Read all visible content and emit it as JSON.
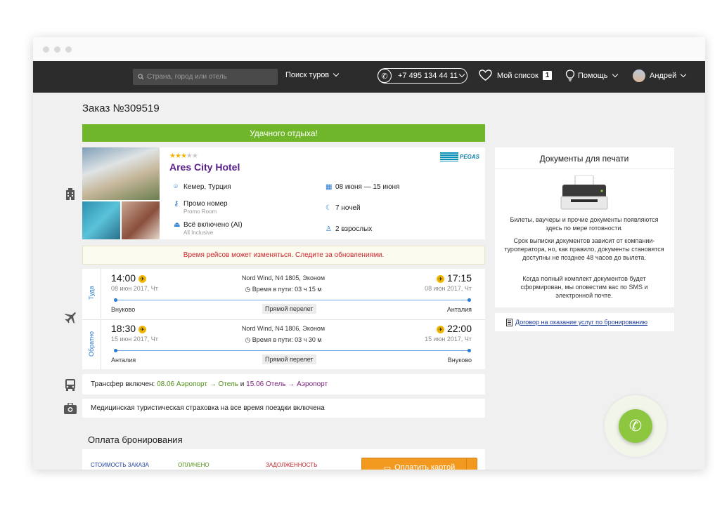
{
  "header": {
    "search_placeholder": "Страна, город или отель",
    "tours_label": "Поиск туров",
    "phone": "+7 495 134 44 11",
    "wishlist_label": "Мой список",
    "wishlist_count": "1",
    "help_label": "Помощь",
    "user_name": "Андрей"
  },
  "order": {
    "title": "Заказ №309519",
    "banner": "Удачного отдыха!"
  },
  "hotel": {
    "stars": 3,
    "stars_max": 5,
    "name": "Ares City Hotel",
    "operator": "PEGAS",
    "location": "Кемер, Турция",
    "dates": "08 июня — 15 июня",
    "room": "Промо номер",
    "room_sub": "Promo Room",
    "nights": "7 ночей",
    "board": "Всё включено (AI)",
    "board_sub": "All Inclusive",
    "guests": "2 взрослых"
  },
  "notice": "Время рейсов может изменяться. Следите за обновлениями.",
  "flights": [
    {
      "direction": "Туда",
      "dep_time": "14:00",
      "dep_date": "08 июн 2017, Чт",
      "flight": "Nord Wind, N4 1805, Эконом",
      "duration": "Время в пути: 03 ч 15 м",
      "arr_time": "17:15",
      "arr_date": "08 июн 2017, Чт",
      "from": "Внуково",
      "type": "Прямой перелет",
      "to": "Анталия"
    },
    {
      "direction": "Обратно",
      "dep_time": "18:30",
      "dep_date": "15 июн 2017, Чт",
      "flight": "Nord Wind, N4 1806, Эконом",
      "duration": "Время в пути: 03 ч 30 м",
      "arr_time": "22:00",
      "arr_date": "15 июн 2017, Чт",
      "from": "Анталия",
      "type": "Прямой перелет",
      "to": "Внуково"
    }
  ],
  "transfer": {
    "prefix": "Трансфер включен:",
    "part1": "08.06 Аэропорт",
    "arrow1": "→",
    "part1b": "Отель",
    "and": "и",
    "part2": "15.06 Отель",
    "arrow2": "→",
    "part2b": "Аэропорт"
  },
  "insurance": "Медицинская туристическая страховка на все время поездки включена",
  "documents": {
    "title": "Документы для печати",
    "p1": "Билеты, ваучеры и прочие документы появляются здесь по мере готовности.",
    "p2": "Срок выписки документов зависит от компании-туроператора, но, как правило, документы становятся доступны не позднее 48 часов до вылета.",
    "p3": "Когда полный комплект документов будет сформирован, мы оповестим вас по SMS и электронной почте.",
    "contract_link": "Договор на оказание услуг по бронированию"
  },
  "payment": {
    "title": "Оплата бронирования",
    "cost_label": "СТОИМОСТЬ ЗАКАЗА",
    "paid_label": "ОПЛАЧЕНО",
    "debt_label": "ЗАДОЛЖЕННОСТЬ",
    "pay_button": "Оплатить картой"
  },
  "colors": {
    "navbar": "#2c2c2c",
    "banner_green": "#6fb62b",
    "hotel_name": "#5a1e8c",
    "accent_blue": "#2b7bd1",
    "notice_red": "#d0262b",
    "pay_orange": "#f29a1f"
  },
  "icons": {
    "search": "search-icon",
    "phone": "phone-icon",
    "heart": "heart-icon",
    "help": "help-bulb-icon",
    "building": "building-icon",
    "plane": "plane-icon",
    "bus": "bus-icon",
    "medkit": "medkit-icon"
  }
}
